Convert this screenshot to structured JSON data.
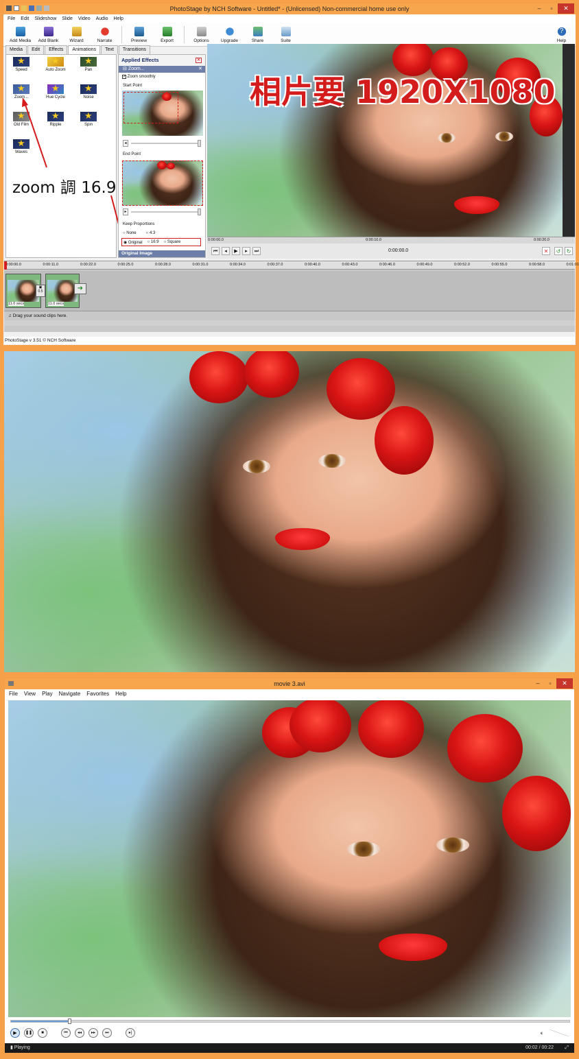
{
  "photostage": {
    "title": "PhotoStage by NCH Software - Untitled* - (Unlicensed) Non-commercial home use only",
    "menu": [
      "File",
      "Edit",
      "Slideshow",
      "Slide",
      "Video",
      "Audio",
      "Help"
    ],
    "toolbar": [
      "Add Media",
      "Add Blank",
      "Wizard",
      "Narrate",
      "Preview",
      "Export",
      "Options",
      "Upgrade",
      "Share",
      "Suite"
    ],
    "help_label": "Help",
    "tabs": [
      "Media",
      "Edit",
      "Effects",
      "Animations",
      "Text",
      "Transitions"
    ],
    "active_tab": "Animations",
    "effects": [
      "Speed",
      "Auto Zoom",
      "Pan",
      "Zoom...",
      "Hue Cycle",
      "Noise",
      "Old Film",
      "Ripple",
      "Spin",
      "Waves"
    ],
    "applied_effects": {
      "heading": "Applied Effects",
      "effect_name": "Zoom...",
      "zoom_smoothly": "Zoom smoothly",
      "start_point": "Start Point",
      "end_point": "End Point",
      "keep_proportions": "Keep Proportions",
      "options": [
        "None",
        "4:3",
        "Original",
        "16:9",
        "Square"
      ],
      "selected": "Original",
      "original_image": "Original Image"
    },
    "annotation_top": "相片要 1920X1080",
    "annotation_left": "zoom 調 16.9",
    "preview_ruler": [
      "0:00:00.0",
      "0:00:10.0",
      "0:00:20.0"
    ],
    "time_display": "0:00:00.0",
    "timeline_ticks": [
      "0:00:00.0",
      "0:00:11.0",
      "0:00:22.0",
      "0:00:25.0",
      "0:00:28.0",
      "0:00:31.0",
      "0:00:34.0",
      "0:00:37.0",
      "0:00:40.0",
      "0:00:43.0",
      "0:00:46.0",
      "0:00:49.0",
      "0:00:52.0",
      "0:00:55.0",
      "0:00:58.0",
      "0:01:01.0"
    ],
    "clips": [
      {
        "duration": "11.0 secs"
      },
      {
        "duration": "11.0 secs"
      }
    ],
    "transition_label": "0.5",
    "sound_hint": "Drag your sound clips here.",
    "statusbar": "PhotoStage v 3.51 © NCH Software"
  },
  "player": {
    "title": "movie 3.avi",
    "menu": [
      "File",
      "View",
      "Play",
      "Navigate",
      "Favorites",
      "Help"
    ],
    "status": "Playing",
    "time": "00:02 / 00:22"
  },
  "colors": {
    "frame": "#f6a14a",
    "titlebar": "#f7a64e",
    "close": "#c7352a",
    "annotation": "#d41c1c"
  }
}
